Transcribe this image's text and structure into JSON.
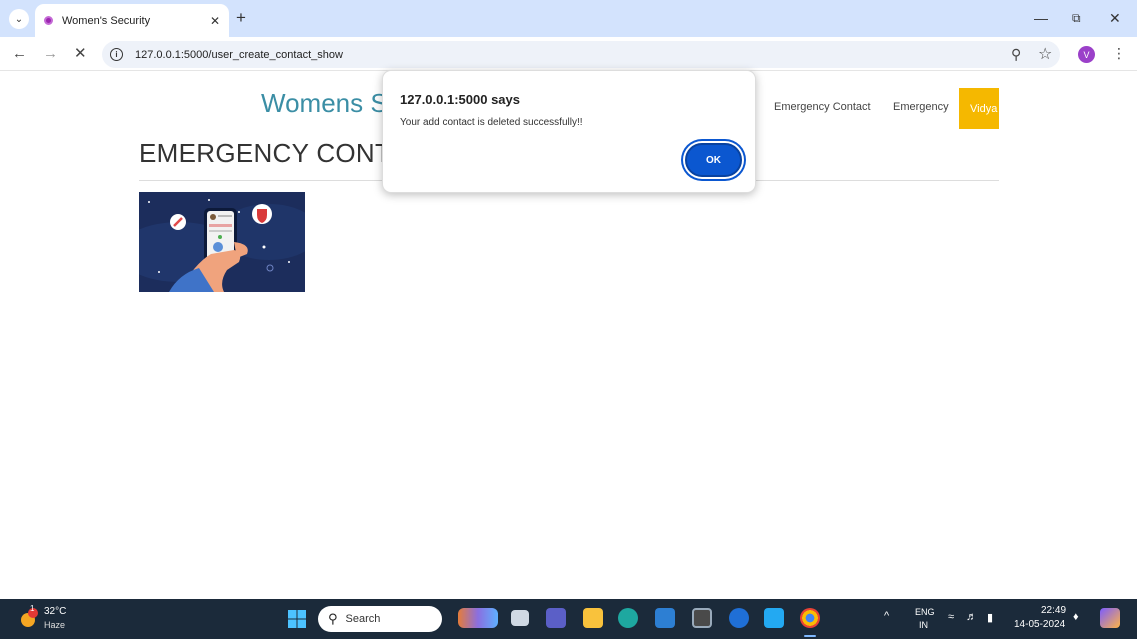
{
  "browser": {
    "tab_title": "Women's Security",
    "url": "127.0.0.1:5000/user_create_contact_show",
    "profile_initial": "V",
    "win_controls": [
      "—",
      "⧉",
      "✕"
    ]
  },
  "page": {
    "site_title": "Womens S",
    "nav": {
      "emergency_contact": "Emergency Contact",
      "emergency": "Emergency",
      "user": "Vidya"
    },
    "heading": "EMERGENCY CONT"
  },
  "dialog": {
    "title": "127.0.0.1:5000 says",
    "message": "Your add contact is deleted successfully!!",
    "ok_label": "OK"
  },
  "taskbar": {
    "weather_temp": "32°C",
    "weather_desc": "Haze",
    "weather_badge": "1",
    "search_label": "Search",
    "lang_top": "ENG",
    "lang_bottom": "IN",
    "time": "22:49",
    "date": "14-05-2024"
  },
  "colors": {
    "tab_strip": "#d3e3fd",
    "site_title": "#3b8ea5",
    "user_badge": "#f5b800",
    "ok_button": "#0b57d0",
    "taskbar": "#1b2a3a"
  }
}
